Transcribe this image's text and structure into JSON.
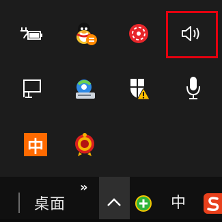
{
  "tray_flyout": {
    "icons": [
      {
        "name": "power-battery-icon"
      },
      {
        "name": "qq-icon"
      },
      {
        "name": "antivirus-icon"
      },
      {
        "name": "volume-icon"
      },
      {
        "name": "network-icon"
      },
      {
        "name": "disk-sync-icon"
      },
      {
        "name": "windows-security-warning-icon"
      },
      {
        "name": "microphone-icon"
      },
      {
        "name": "ime-chinese-icon",
        "label": "中"
      },
      {
        "name": "app-badge-icon"
      }
    ],
    "highlight_color": "#e3000f"
  },
  "taskbar": {
    "desktop_label": "桌面",
    "expand_label": "»",
    "ime_label": "中",
    "accent_orange": "#ff6a00",
    "accent_green": "#2fb43a"
  }
}
